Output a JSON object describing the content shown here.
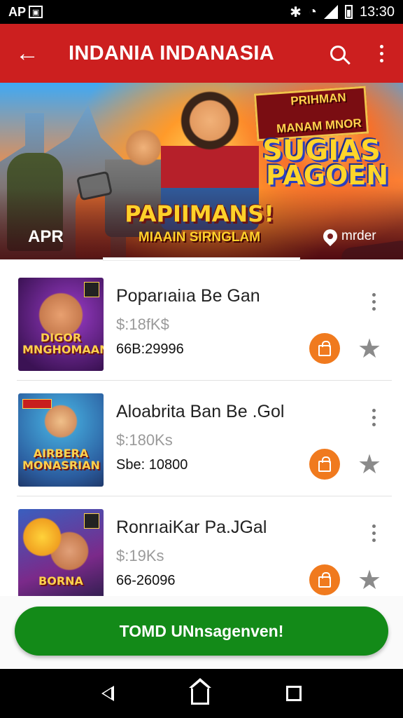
{
  "status_bar": {
    "left_text": "AP",
    "left_icon": "notification-icon",
    "time": "13:30",
    "icons": [
      "vibrate-icon",
      "wifi-icon",
      "signal-icon",
      "battery-icon"
    ]
  },
  "app_bar": {
    "title": "INDANIA INDANASIA",
    "back_icon": "arrow-left-icon",
    "search_icon": "search-icon",
    "more_icon": "more-vert-icon",
    "color": "#cc1f1f"
  },
  "banner": {
    "tag_line1": "PRIHMAN",
    "tag_line2": "MANAM MNOR",
    "game_title_line1": "SUGIAS",
    "game_title_line2": "PAGOEN",
    "main_title": "PAPIIMANS!",
    "subtitle": "MIAAIN SIRNGLAM",
    "left_label": "APR",
    "brand_label": "mrder",
    "brand_icon": "pin-icon"
  },
  "items": [
    {
      "title": "Poparıaiıa Be Gan",
      "price": "$:18fK$",
      "code": "66B:29996",
      "thumb_text": "DIGOR MNGHOMAAN"
    },
    {
      "title": "Aloabrita Ban Be .Gol",
      "price": "$:180Ks",
      "code": "Sbe: 10800",
      "thumb_text": "AIRBERA MONASRIAN"
    },
    {
      "title": "RonrıaiKar Pa.JGal",
      "price": "$:19Ks",
      "code": "66-26096",
      "thumb_text": "BORNA"
    }
  ],
  "item_icons": {
    "more": "more-vert-icon",
    "bag": "shopping-bag-icon",
    "star": "star-icon"
  },
  "cta": {
    "label": "TOMD UNnsagenven!",
    "color": "#138a18"
  },
  "accent_colors": {
    "bag": "#f07a1e",
    "star": "#8b8b8b"
  },
  "nav_bar": {
    "icons": [
      "back-triangle-icon",
      "home-icon",
      "recent-apps-icon"
    ]
  }
}
